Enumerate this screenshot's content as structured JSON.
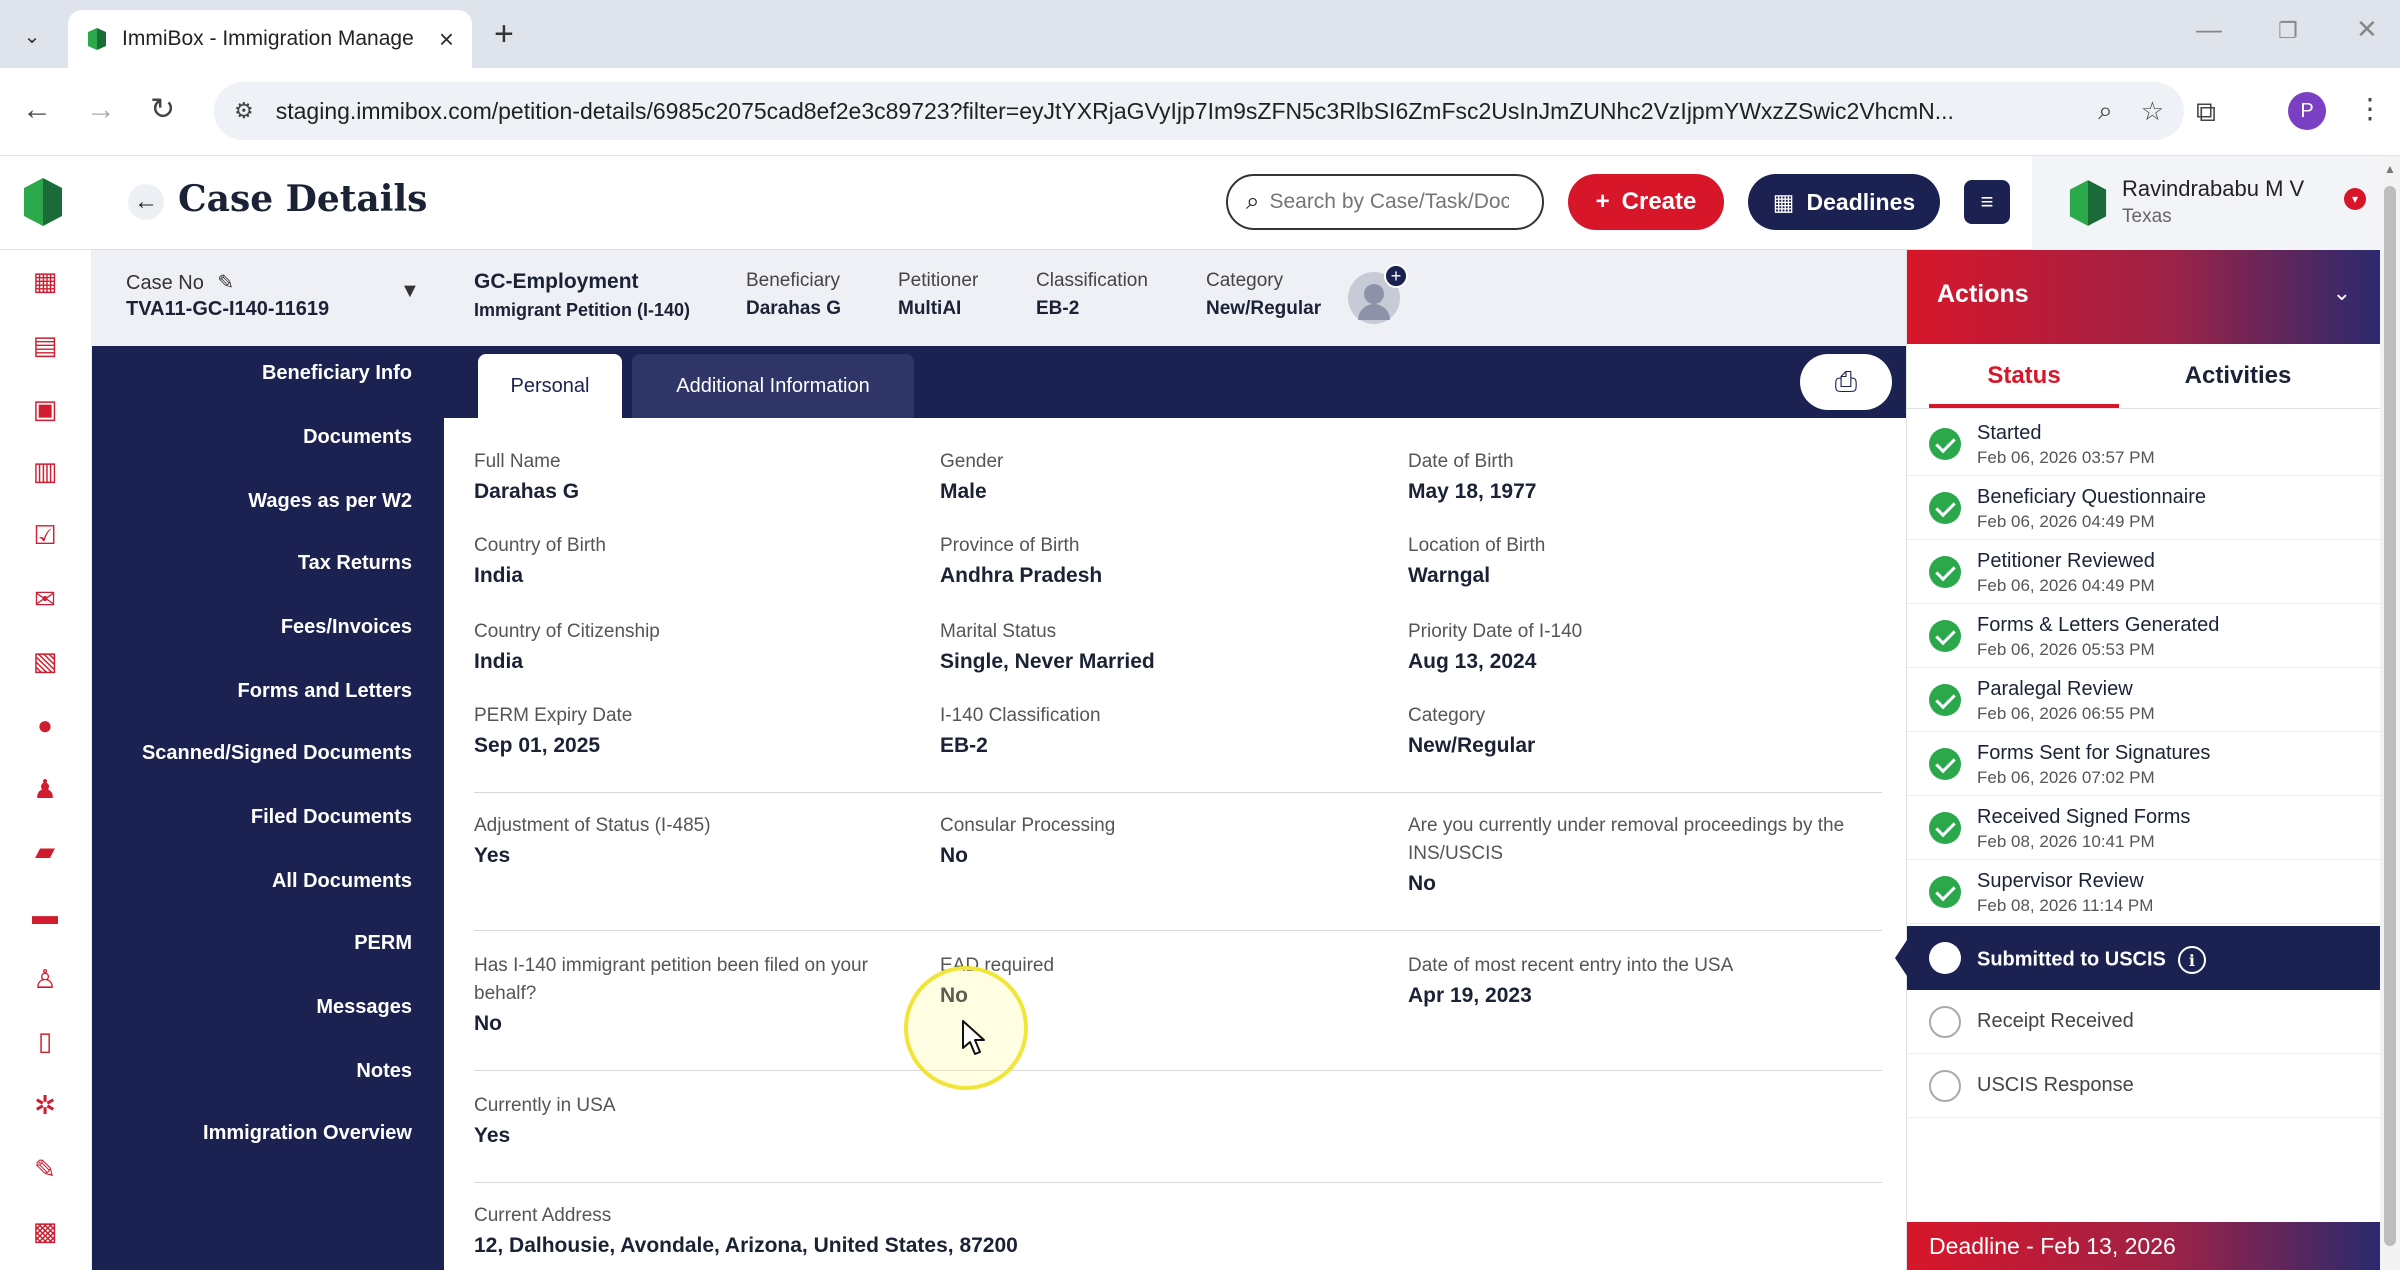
{
  "browser": {
    "tab_title": "ImmiBox - Immigration Manage",
    "url": "staging.immibox.com/petition-details/6985c2075cad8ef2e3c89723?filter=eyJtYXRjaGVyIjp7Im9sZFN5c3RlbSI6ZmFsc2UsInJmZUNhc2VzIjpmYWxzZSwic2VhcmN..."
  },
  "header": {
    "title": "Case Details",
    "search_placeholder": "Search by Case/Task/Docu",
    "create_label": "Create",
    "deadlines_label": "Deadlines",
    "user_name": "Ravindrababu M V",
    "user_location": "Texas"
  },
  "case_bar": {
    "case_no_label": "Case No",
    "case_no": "TVA11-GC-I140-11619",
    "case_type": "GC-Employment",
    "case_subtype": "Immigrant Petition (I-140)",
    "beneficiary_label": "Beneficiary",
    "beneficiary": "Darahas G",
    "petitioner_label": "Petitioner",
    "petitioner": "MultiAI",
    "classification_label": "Classification",
    "classification": "EB-2",
    "category_label": "Category",
    "category": "New/Regular"
  },
  "leftnav": [
    "Beneficiary Info",
    "Documents",
    "Wages as per W2",
    "Tax Returns",
    "Fees/Invoices",
    "Forms and Letters",
    "Scanned/Signed Documents",
    "Filed Documents",
    "All Documents",
    "PERM",
    "Messages",
    "Notes",
    "Immigration Overview"
  ],
  "tabs": {
    "personal": "Personal",
    "additional": "Additional Information"
  },
  "fields": {
    "full_name": {
      "label": "Full Name",
      "value": "Darahas G"
    },
    "gender": {
      "label": "Gender",
      "value": "Male"
    },
    "dob": {
      "label": "Date of Birth",
      "value": "May 18, 1977"
    },
    "country_birth": {
      "label": "Country of Birth",
      "value": "India"
    },
    "province_birth": {
      "label": "Province of Birth",
      "value": "Andhra Pradesh"
    },
    "location_birth": {
      "label": "Location of Birth",
      "value": "Warngal"
    },
    "citizenship": {
      "label": "Country of Citizenship",
      "value": "India"
    },
    "marital": {
      "label": "Marital Status",
      "value": "Single, Never Married"
    },
    "priority_date": {
      "label": "Priority Date of I-140",
      "value": "Aug 13, 2024"
    },
    "perm_expiry": {
      "label": "PERM Expiry Date",
      "value": "Sep 01, 2025"
    },
    "i140_class": {
      "label": "I-140 Classification",
      "value": "EB-2"
    },
    "category": {
      "label": "Category",
      "value": "New/Regular"
    },
    "adjustment": {
      "label": "Adjustment of Status (I-485)",
      "value": "Yes"
    },
    "consular": {
      "label": "Consular Processing",
      "value": "No"
    },
    "removal": {
      "label": "Are you currently under removal proceedings by the INS/USCIS",
      "value": "No"
    },
    "i140_filed": {
      "label": "Has I-140 immigrant petition been filed on your behalf?",
      "value": "No"
    },
    "ead": {
      "label": "EAD required",
      "value": "No"
    },
    "recent_entry": {
      "label": "Date of most recent entry into the USA",
      "value": "Apr 19, 2023"
    },
    "in_usa": {
      "label": "Currently in USA",
      "value": "Yes"
    },
    "address": {
      "label": "Current Address",
      "value": "12, Dalhousie, Avondale, Arizona, United States, 87200"
    }
  },
  "actions": {
    "title": "Actions",
    "tab_status": "Status",
    "tab_activities": "Activities",
    "steps": [
      {
        "name": "Started",
        "date": "Feb 06, 2026 03:57 PM",
        "state": "done"
      },
      {
        "name": "Beneficiary Questionnaire",
        "date": "Feb 06, 2026 04:49 PM",
        "state": "done"
      },
      {
        "name": "Petitioner Reviewed",
        "date": "Feb 06, 2026 04:49 PM",
        "state": "done"
      },
      {
        "name": "Forms & Letters Generated",
        "date": "Feb 06, 2026 05:53 PM",
        "state": "done"
      },
      {
        "name": "Paralegal Review",
        "date": "Feb 06, 2026 06:55 PM",
        "state": "done"
      },
      {
        "name": "Forms Sent for Signatures",
        "date": "Feb 06, 2026 07:02 PM",
        "state": "done"
      },
      {
        "name": "Received Signed Forms",
        "date": "Feb 08, 2026 10:41 PM",
        "state": "done"
      },
      {
        "name": "Supervisor Review",
        "date": "Feb 08, 2026 11:14 PM",
        "state": "done"
      },
      {
        "name": "Submitted to USCIS",
        "date": "",
        "state": "current"
      },
      {
        "name": "Receipt Received",
        "date": "",
        "state": "pending"
      },
      {
        "name": "USCIS Response",
        "date": "",
        "state": "pending"
      }
    ],
    "deadline": "Deadline - Feb 13, 2026"
  },
  "colors": {
    "brand_red": "#d8162a",
    "navy": "#1b2150",
    "success": "#2aa84a"
  }
}
